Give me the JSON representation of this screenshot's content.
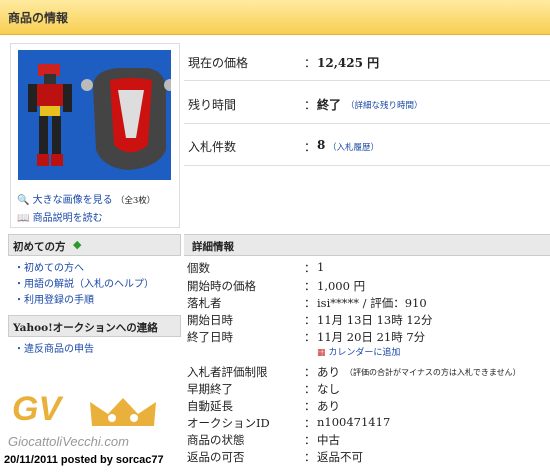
{
  "header": {
    "title": "商品の情報"
  },
  "image_links": {
    "large_image": "大きな画像を見る",
    "count": "（全3枚）",
    "description": "商品説明を読む"
  },
  "summary": [
    {
      "label": "現在の価格",
      "value": "12,425 円",
      "link": ""
    },
    {
      "label": "残り時間",
      "value": "終了",
      "link": "（詳細な残り時間）"
    },
    {
      "label": "入札件数",
      "value": "8",
      "link": "（入札履歴）"
    }
  ],
  "colon": "：",
  "sidebar": {
    "first_time": {
      "title": "初めての方",
      "items": [
        "・初めての方へ",
        "・用語の解説（入札のヘルプ）",
        "・利用登録の手順"
      ]
    },
    "contact": {
      "title": "Yahoo!オークションへの連絡",
      "items": [
        "・違反商品の申告"
      ]
    }
  },
  "details": {
    "title": "詳細情報",
    "rows": [
      {
        "label": "個数",
        "value": "1"
      },
      {
        "label": "開始時の価格",
        "value": "1,000 円"
      },
      {
        "label": "落札者",
        "value": "isi***** / 評価：910"
      },
      {
        "label": "開始日時",
        "value": "11月 13日 13時 12分"
      },
      {
        "label": "終了日時",
        "value": "11月 20日 21時 7分"
      },
      {
        "label": "入札者評価制限",
        "value": "あり",
        "note": "（評価の合計がマイナスの方は入札できません）"
      },
      {
        "label": "早期終了",
        "value": "なし"
      },
      {
        "label": "自動延長",
        "value": "あり"
      },
      {
        "label": "オークションID",
        "value": "n100471417"
      },
      {
        "label": "商品の状態",
        "value": "中古"
      },
      {
        "label": "返品の可否",
        "value": "返品不可"
      }
    ],
    "calendar_link": "カレンダーに追加"
  },
  "watermark": {
    "logo": "GV",
    "site": "GiocattoliVecchi.com",
    "caption": "20/11/2011 posted by sorcac77"
  },
  "colors": {
    "header_top": "#ffeaa0",
    "header_bottom": "#f8cf52",
    "link": "#1a48a8",
    "gold": "#e9b13b"
  }
}
